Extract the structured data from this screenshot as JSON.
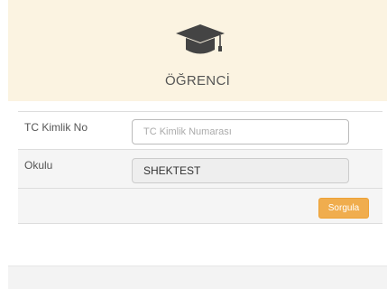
{
  "header": {
    "icon": "graduation-cap-icon",
    "title": "ÖĞRENCİ"
  },
  "form": {
    "tc": {
      "label": "TC Kimlik No",
      "placeholder": "TC Kimlik Numarası",
      "value": ""
    },
    "school": {
      "label": "Okulu",
      "value": "SHEKTEST"
    },
    "submit_label": "Sorgula"
  },
  "colors": {
    "header_bg": "#fbf3e1",
    "icon": "#444444",
    "button": "#f0ad4e"
  }
}
